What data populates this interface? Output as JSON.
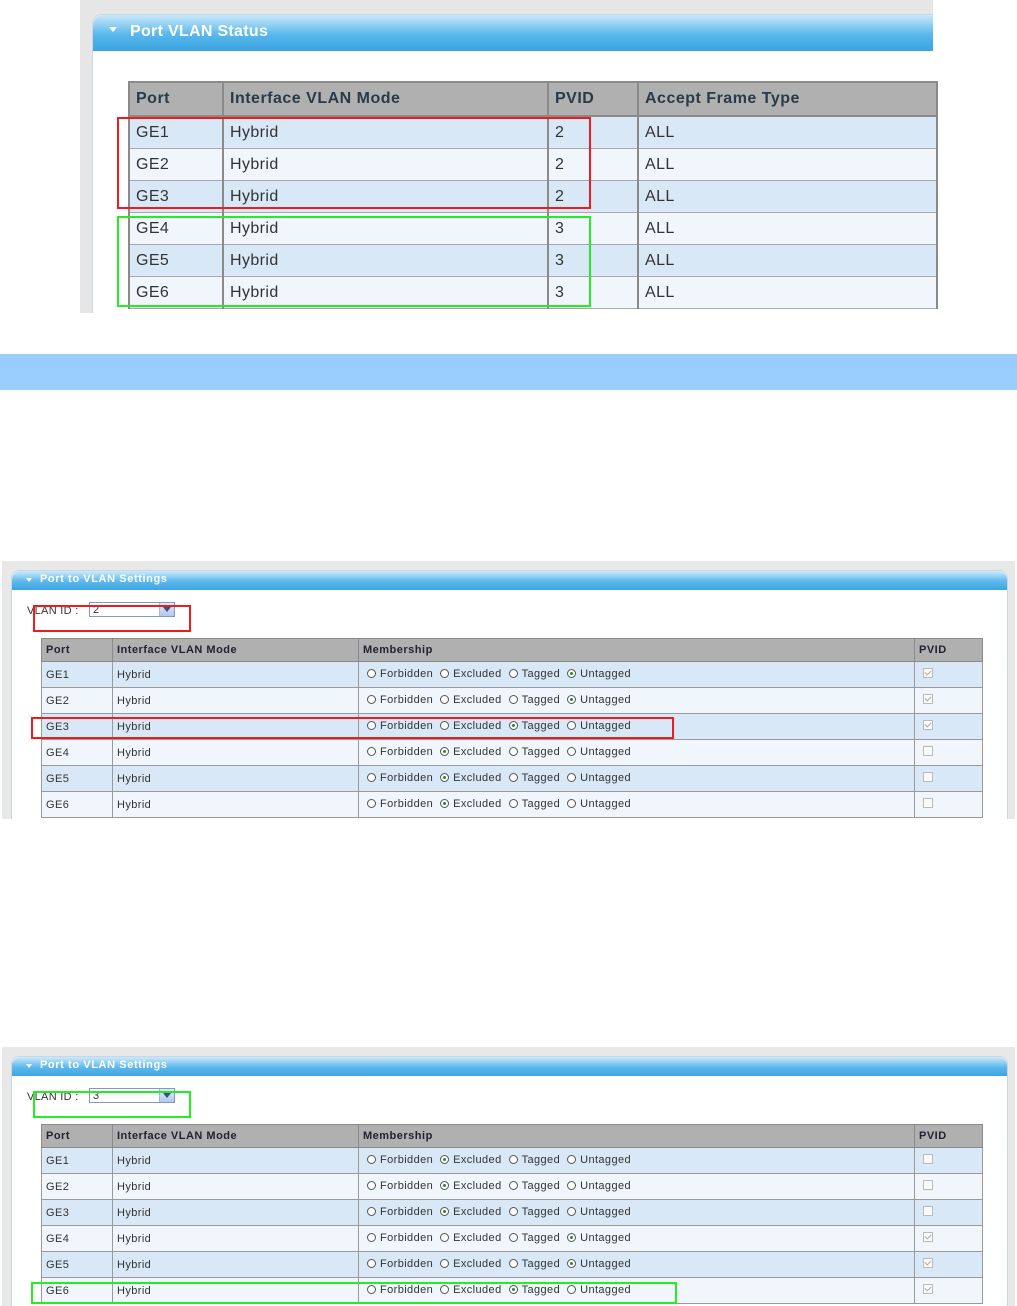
{
  "status_panel": {
    "title": "Port VLAN Status",
    "headers": [
      "Port",
      "Interface VLAN Mode",
      "PVID",
      "Accept Frame Type"
    ],
    "rows": [
      {
        "port": "GE1",
        "mode": "Hybrid",
        "pvid": "2",
        "accept": "ALL"
      },
      {
        "port": "GE2",
        "mode": "Hybrid",
        "pvid": "2",
        "accept": "ALL"
      },
      {
        "port": "GE3",
        "mode": "Hybrid",
        "pvid": "2",
        "accept": "ALL"
      },
      {
        "port": "GE4",
        "mode": "Hybrid",
        "pvid": "3",
        "accept": "ALL"
      },
      {
        "port": "GE5",
        "mode": "Hybrid",
        "pvid": "3",
        "accept": "ALL"
      },
      {
        "port": "GE6",
        "mode": "Hybrid",
        "pvid": "3",
        "accept": "ALL"
      }
    ]
  },
  "settings_a": {
    "title": "Port to VLAN Settings",
    "vlan_label": "VLAN ID :",
    "vlan_value": "2",
    "headers": [
      "Port",
      "Interface VLAN Mode",
      "Membership",
      "PVID"
    ],
    "options": [
      "Forbidden",
      "Excluded",
      "Tagged",
      "Untagged"
    ],
    "rows": [
      {
        "port": "GE1",
        "mode": "Hybrid",
        "membership": "Untagged",
        "pvid_checked": true
      },
      {
        "port": "GE2",
        "mode": "Hybrid",
        "membership": "Untagged",
        "pvid_checked": true
      },
      {
        "port": "GE3",
        "mode": "Hybrid",
        "membership": "Tagged",
        "pvid_checked": true
      },
      {
        "port": "GE4",
        "mode": "Hybrid",
        "membership": "Excluded",
        "pvid_checked": false
      },
      {
        "port": "GE5",
        "mode": "Hybrid",
        "membership": "Excluded",
        "pvid_checked": false
      },
      {
        "port": "GE6",
        "mode": "Hybrid",
        "membership": "Excluded",
        "pvid_checked": false
      }
    ]
  },
  "settings_b": {
    "title": "Port to VLAN Settings",
    "vlan_label": "VLAN ID :",
    "vlan_value": "3",
    "headers": [
      "Port",
      "Interface VLAN Mode",
      "Membership",
      "PVID"
    ],
    "options": [
      "Forbidden",
      "Excluded",
      "Tagged",
      "Untagged"
    ],
    "rows": [
      {
        "port": "GE1",
        "mode": "Hybrid",
        "membership": "Excluded",
        "pvid_checked": false
      },
      {
        "port": "GE2",
        "mode": "Hybrid",
        "membership": "Excluded",
        "pvid_checked": false
      },
      {
        "port": "GE3",
        "mode": "Hybrid",
        "membership": "Excluded",
        "pvid_checked": false
      },
      {
        "port": "GE4",
        "mode": "Hybrid",
        "membership": "Untagged",
        "pvid_checked": true
      },
      {
        "port": "GE5",
        "mode": "Hybrid",
        "membership": "Untagged",
        "pvid_checked": true
      },
      {
        "port": "GE6",
        "mode": "Hybrid",
        "membership": "Tagged",
        "pvid_checked": true
      }
    ]
  },
  "colors": {
    "highlight_red": "#ee1c1c",
    "highlight_green": "#22ee22",
    "band": "#99ccff",
    "header_blue": "#3ea5e0"
  }
}
